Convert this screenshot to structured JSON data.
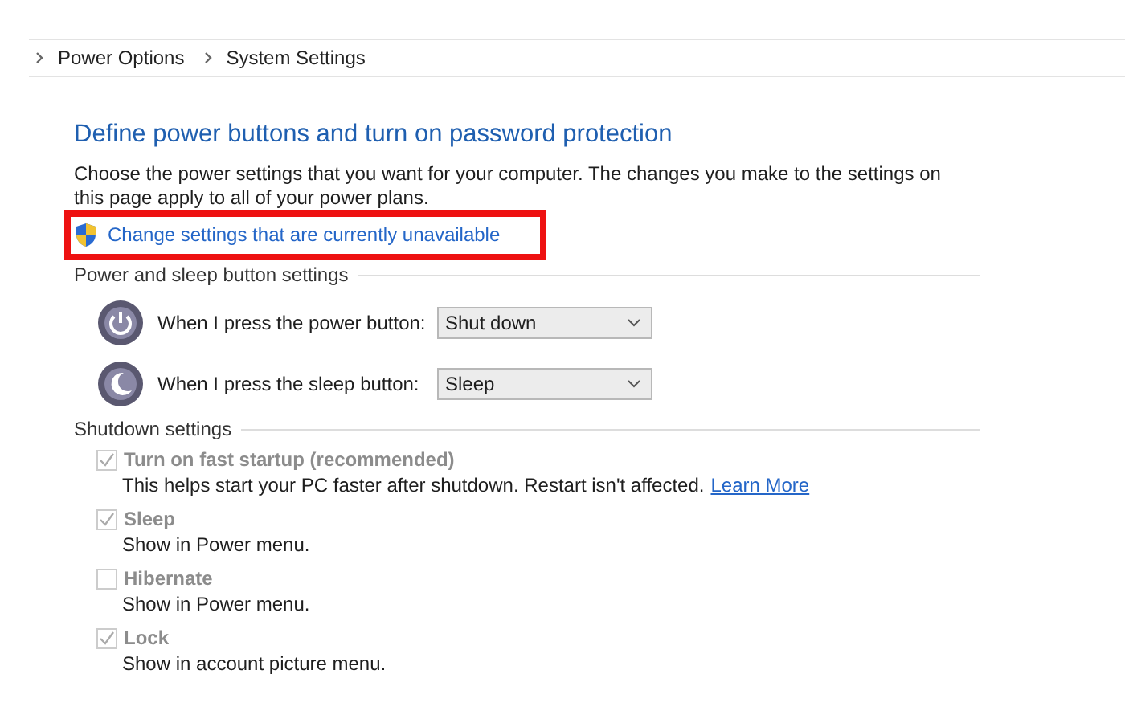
{
  "breadcrumb": [
    "Power Options",
    "System Settings"
  ],
  "title": "Define power buttons and turn on password protection",
  "description": "Choose the power settings that you want for your computer. The changes you make to the settings on this page apply to all of your power plans.",
  "admin_link": {
    "label": "Change settings that are currently unavailable",
    "highlighted": true
  },
  "button_section": {
    "heading": "Power and sleep button settings",
    "rows": [
      {
        "kind": "power",
        "label": "When I press the power button:",
        "value": "Shut down"
      },
      {
        "kind": "sleep",
        "label": "When I press the sleep button:",
        "value": "Sleep"
      }
    ]
  },
  "shutdown_section": {
    "heading": "Shutdown settings",
    "options": [
      {
        "label": "Turn on fast startup (recommended)",
        "checked": true,
        "disabled": true,
        "description": "This helps start your PC faster after shutdown. Restart isn't affected.",
        "link": "Learn More"
      },
      {
        "label": "Sleep",
        "checked": true,
        "disabled": true,
        "description": "Show in Power menu."
      },
      {
        "label": "Hibernate",
        "checked": false,
        "disabled": true,
        "description": "Show in Power menu."
      },
      {
        "label": "Lock",
        "checked": true,
        "disabled": true,
        "description": "Show in account picture menu."
      }
    ]
  }
}
